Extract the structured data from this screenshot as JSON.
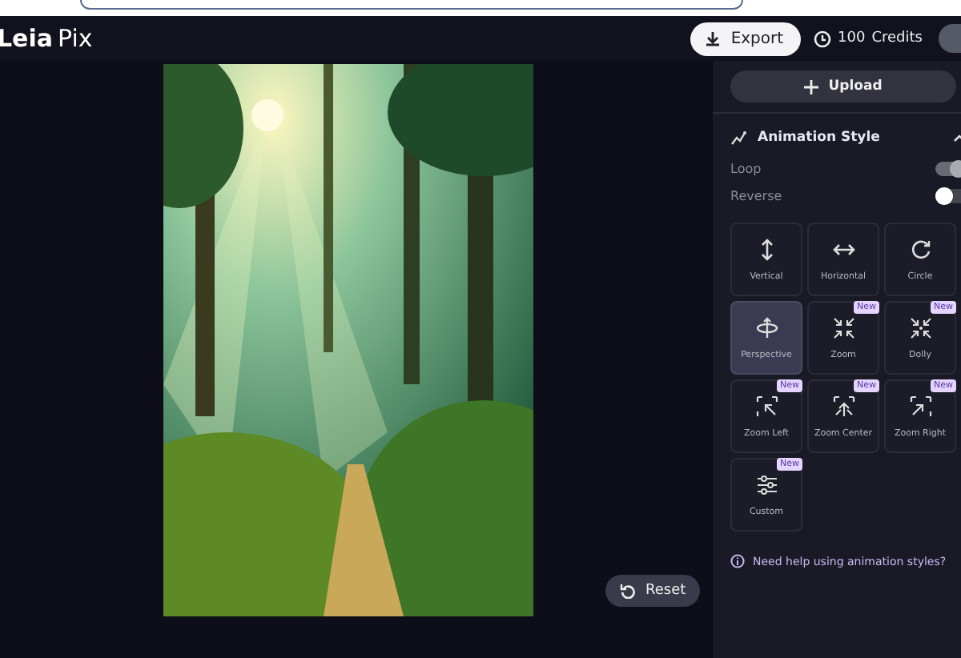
{
  "header": {
    "logo_bold": "Leia",
    "logo_light": "Pix",
    "export_label": "Export",
    "credits": "100",
    "credits_label": "Credits"
  },
  "canvas": {
    "reset_label": "Reset"
  },
  "panel": {
    "upload_label": "Upload",
    "section_title": "Animation Style",
    "expanded": true,
    "toggles": [
      {
        "label": "Loop",
        "on": true
      },
      {
        "label": "Reverse",
        "on": false
      }
    ],
    "styles": [
      {
        "kind": "vertical",
        "label": "Vertical",
        "selected": false
      },
      {
        "kind": "horizontal",
        "label": "Horizontal",
        "selected": false
      },
      {
        "kind": "circle",
        "label": "Circle",
        "selected": false
      },
      {
        "kind": "perspective",
        "label": "Perspective",
        "selected": true
      },
      {
        "kind": "zoom",
        "label": "Zoom",
        "selected": false,
        "badge": "New"
      },
      {
        "kind": "dolly",
        "label": "Dolly",
        "selected": false,
        "badge": "New"
      },
      {
        "kind": "zoom-left",
        "label": "Zoom Left",
        "selected": false,
        "badge": "New"
      },
      {
        "kind": "zoom-center",
        "label": "Zoom Center",
        "selected": false,
        "badge": "New"
      },
      {
        "kind": "zoom-right",
        "label": "Zoom Right",
        "selected": false,
        "badge": "New"
      },
      {
        "kind": "custom",
        "label": "Custom",
        "selected": false,
        "badge": "New"
      }
    ],
    "help_text": "Need help using animation styles?"
  }
}
